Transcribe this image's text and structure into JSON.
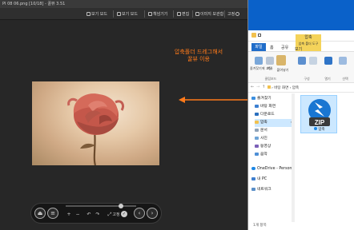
{
  "viewer": {
    "title": "PI 08 06.png [10/18] - 꿀뷰 3.51",
    "menu": [
      {
        "label": "보기 모드"
      },
      {
        "label": "보기 모드"
      },
      {
        "label": "책넘기기"
      },
      {
        "label": "편집"
      },
      {
        "label": "이미지 보관함"
      },
      {
        "label": "고정"
      }
    ],
    "annotation_line1": "압축폴더 드레그해서",
    "annotation_line2": "꿀뷰 이용",
    "toolbar": {
      "plus": "+",
      "minus": "−",
      "fixed_label": "고정"
    }
  },
  "explorer": {
    "compress_tab": {
      "line1": "압축",
      "line2": "압축 폴더 도구"
    },
    "ribbon_tabs": [
      "파일",
      "홈",
      "공유",
      "보기"
    ],
    "ribbon_groups": [
      "클립보드",
      "구성",
      "열기",
      "선택"
    ],
    "ribbon_buttons": [
      "즐겨찾기에 고정",
      "복사",
      "붙여넣기"
    ],
    "address": "› 바탕 화면 › 압축",
    "nav_items": [
      {
        "label": "즐겨찾기"
      },
      {
        "label": "바탕 화면"
      },
      {
        "label": "다운로드"
      },
      {
        "label": "압축"
      },
      {
        "label": "문서"
      },
      {
        "label": "사진"
      },
      {
        "label": "동영상"
      },
      {
        "label": "음악"
      },
      {
        "label": "OneDrive - Personal"
      },
      {
        "label": "내 PC"
      },
      {
        "label": "네트워크"
      }
    ],
    "zip_file": {
      "badge": "ZIP",
      "name": "압축"
    },
    "status": "1개 항목"
  },
  "colors": {
    "annotation": "#ff7a1a",
    "explorer_accent": "#0a61c9",
    "selection": "#cce8ff"
  }
}
